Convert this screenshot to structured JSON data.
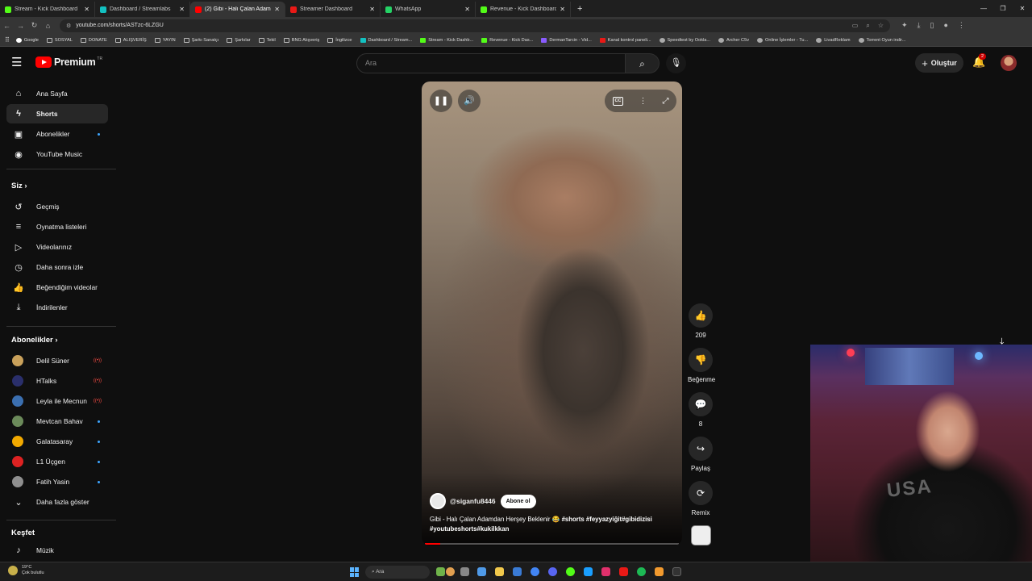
{
  "browser": {
    "tabs": [
      {
        "title": "Stream - Kick Dashboard",
        "color": "#53fc18",
        "active": false
      },
      {
        "title": "Dashboard / Streamlabs",
        "color": "#13c1c1",
        "active": false
      },
      {
        "title": "(2) Gibi - Halı Çalan Adamd",
        "color": "#ff0000",
        "active": true
      },
      {
        "title": "Streamer Dashboard",
        "color": "#e91916",
        "active": false
      },
      {
        "title": "WhatsApp",
        "color": "#25d366",
        "active": false
      },
      {
        "title": "Revenue - Kick Dashboard",
        "color": "#53fc18",
        "active": false
      }
    ],
    "new_tab": "+",
    "url": "youtube.com/shorts/ASTzc-6LZGU",
    "bookmarks": [
      {
        "label": "Google",
        "kind": "g"
      },
      {
        "label": "SOSYAL",
        "kind": ""
      },
      {
        "label": "DONATE",
        "kind": ""
      },
      {
        "label": "ALIŞVERİŞ",
        "kind": ""
      },
      {
        "label": "YAYIN",
        "kind": ""
      },
      {
        "label": "Şarkı Sanatçı",
        "kind": ""
      },
      {
        "label": "Şarkılar",
        "kind": ""
      },
      {
        "label": "Tekil",
        "kind": ""
      },
      {
        "label": "BNG Alışveriş",
        "kind": ""
      },
      {
        "label": "İngilizce",
        "kind": ""
      },
      {
        "label": "Dashboard / Stream...",
        "kind": "s"
      },
      {
        "label": "Stream - Kick Dashb...",
        "kind": "k"
      },
      {
        "label": "Revenue - Kick Das...",
        "kind": "k"
      },
      {
        "label": "DermanTarcin - Vid...",
        "kind": "v"
      },
      {
        "label": "Kanal kontrol paneli...",
        "kind": "r"
      },
      {
        "label": "Speedtest by Ookla...",
        "kind": "w"
      },
      {
        "label": "Archer C5v",
        "kind": "w"
      },
      {
        "label": "Online İşlemler - Tu...",
        "kind": "w"
      },
      {
        "label": "LivadReklam",
        "kind": "w"
      },
      {
        "label": "Torrent Oyun indir...",
        "kind": "w"
      }
    ]
  },
  "header": {
    "logo_text": "Premium",
    "logo_sup": "TR",
    "search_placeholder": "Ara",
    "create_label": "Oluştur",
    "notif_count": "2"
  },
  "sidebar": {
    "main": [
      {
        "label": "Ana Sayfa",
        "icon": "home-icon",
        "glyph": "⌂"
      },
      {
        "label": "Shorts",
        "icon": "shorts-icon",
        "glyph": "ϟ",
        "selected": true
      },
      {
        "label": "Abonelikler",
        "icon": "subscriptions-icon",
        "glyph": "▣",
        "dot": true
      },
      {
        "label": "YouTube Music",
        "icon": "music-icon",
        "glyph": "◉"
      }
    ],
    "you_title": "Siz",
    "you": [
      {
        "label": "Geçmiş",
        "icon": "history-icon",
        "glyph": "↺"
      },
      {
        "label": "Oynatma listeleri",
        "icon": "playlists-icon",
        "glyph": "≡"
      },
      {
        "label": "Videolarınız",
        "icon": "your-videos-icon",
        "glyph": "▷"
      },
      {
        "label": "Daha sonra izle",
        "icon": "watch-later-icon",
        "glyph": "◷"
      },
      {
        "label": "Beğendiğim videolar",
        "icon": "liked-videos-icon",
        "glyph": "👍"
      },
      {
        "label": "İndirilenler",
        "icon": "downloads-icon",
        "glyph": "⤓"
      }
    ],
    "subs_title": "Abonelikler",
    "subs": [
      {
        "label": "Delil Süner",
        "color": "#c9a15b",
        "live": true
      },
      {
        "label": "HTalks",
        "color": "#2a2f6b",
        "live": true
      },
      {
        "label": "Leyla ile Mecnun",
        "color": "#3b6fb0",
        "live": true
      },
      {
        "label": "Mevtcan Bahav",
        "color": "#6b8a5a",
        "dot": true
      },
      {
        "label": "Galatasaray",
        "color": "#f2a900",
        "dot": true
      },
      {
        "label": "L1 Üçgen",
        "color": "#d22",
        "dot": true
      },
      {
        "label": "Fatih Yasin",
        "color": "#8f8f8f",
        "dot": true
      }
    ],
    "show_more": "Daha fazla göster",
    "explore_title": "Keşfet",
    "explore": [
      {
        "label": "Müzik",
        "icon": "music-note-icon",
        "glyph": "♪"
      }
    ]
  },
  "video": {
    "channel": "@siganfu8446",
    "subscribe": "Abone ol",
    "caption_plain": "Gibi - Halı Çalan Adamdan Herşey Beklenir 😂 ",
    "caption_tags": "#shorts #feyyazyiğit#gibidizisi #youtubeshorts#kukilkkan",
    "progress": 0.06
  },
  "actions": {
    "likes": "209",
    "dislike_label": "Beğenme",
    "comments": "8",
    "share_label": "Paylaş",
    "remix_label": "Remix"
  },
  "taskbar": {
    "temp": "19°C",
    "weather": "Çok bulutlu",
    "search": "Ara"
  }
}
